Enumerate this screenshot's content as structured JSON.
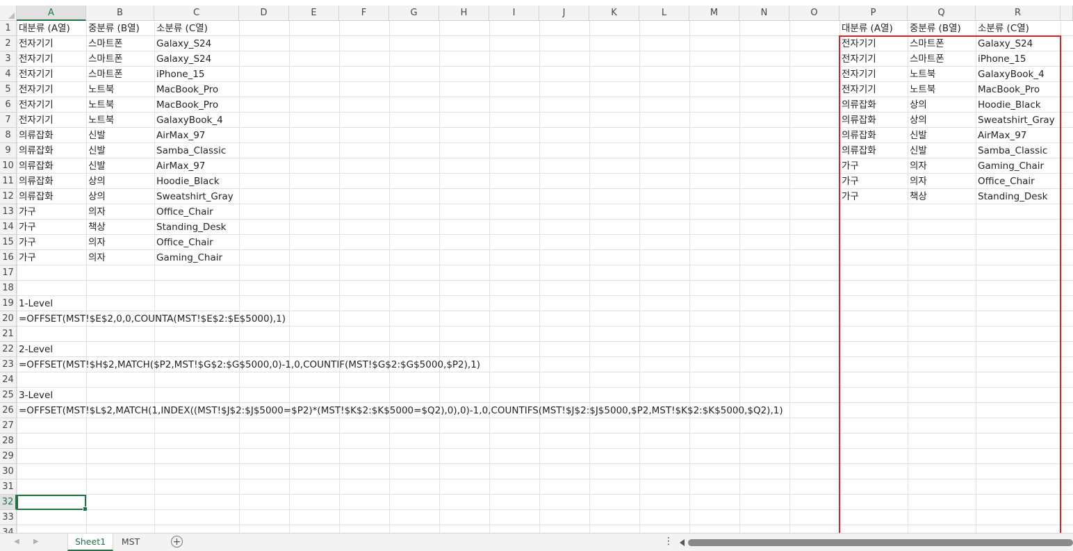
{
  "columns": [
    "A",
    "B",
    "C",
    "D",
    "E",
    "F",
    "G",
    "H",
    "I",
    "J",
    "K",
    "L",
    "M",
    "N",
    "O",
    "P",
    "Q",
    "R"
  ],
  "rows": [
    "1",
    "2",
    "3",
    "4",
    "5",
    "6",
    "7",
    "8",
    "9",
    "10",
    "11",
    "12",
    "13",
    "14",
    "15",
    "16",
    "17",
    "18",
    "19",
    "20",
    "21",
    "22",
    "23",
    "24",
    "25",
    "26",
    "27",
    "28",
    "29",
    "30",
    "31",
    "32",
    "33",
    "34"
  ],
  "selected_cell": "A32",
  "cells": {
    "A1": "대분류 (A열)",
    "B1": "중분류 (B열)",
    "C1": "소분류 (C열)",
    "A2": "전자기기",
    "B2": "스마트폰",
    "C2": "Galaxy_S24",
    "A3": "전자기기",
    "B3": "스마트폰",
    "C3": "Galaxy_S24",
    "A4": "전자기기",
    "B4": "스마트폰",
    "C4": "iPhone_15",
    "A5": "전자기기",
    "B5": "노트북",
    "C5": "MacBook_Pro",
    "A6": "전자기기",
    "B6": "노트북",
    "C6": "MacBook_Pro",
    "A7": "전자기기",
    "B7": "노트북",
    "C7": "GalaxyBook_4",
    "A8": "의류잡화",
    "B8": "신발",
    "C8": "AirMax_97",
    "A9": "의류잡화",
    "B9": "신발",
    "C9": "Samba_Classic",
    "A10": "의류잡화",
    "B10": "신발",
    "C10": "AirMax_97",
    "A11": "의류잡화",
    "B11": "상의",
    "C11": "Hoodie_Black",
    "A12": "의류잡화",
    "B12": "상의",
    "C12": "Sweatshirt_Gray",
    "A13": "가구",
    "B13": "의자",
    "C13": "Office_Chair",
    "A14": "가구",
    "B14": "책상",
    "C14": "Standing_Desk",
    "A15": "가구",
    "B15": "의자",
    "C15": "Office_Chair",
    "A16": "가구",
    "B16": "의자",
    "C16": "Gaming_Chair",
    "A19": "1-Level",
    "A20": "=OFFSET(MST!$E$2,0,0,COUNTA(MST!$E$2:$E$5000),1)",
    "A22": "2-Level",
    "A23": "=OFFSET(MST!$H$2,MATCH($P2,MST!$G$2:$G$5000,0)-1,0,COUNTIF(MST!$G$2:$G$5000,$P2),1)",
    "A25": "3-Level",
    "A26": "=OFFSET(MST!$L$2,MATCH(1,INDEX((MST!$J$2:$J$5000=$P2)*(MST!$K$2:$K$5000=$Q2),0),0)-1,0,COUNTIFS(MST!$J$2:$J$5000,$P2,MST!$K$2:$K$5000,$Q2),1)",
    "P1": "대분류 (A열)",
    "Q1": "중분류 (B열)",
    "R1": "소분류 (C열)",
    "P2": "전자기기",
    "Q2": "스마트폰",
    "R2": "Galaxy_S24",
    "P3": "전자기기",
    "Q3": "스마트폰",
    "R3": "iPhone_15",
    "P4": "전자기기",
    "Q4": "노트북",
    "R4": "GalaxyBook_4",
    "P5": "전자기기",
    "Q5": "노트북",
    "R5": "MacBook_Pro",
    "P6": "의류잡화",
    "Q6": "상의",
    "R6": "Hoodie_Black",
    "P7": "의류잡화",
    "Q7": "상의",
    "R7": "Sweatshirt_Gray",
    "P8": "의류잡화",
    "Q8": "신발",
    "R8": "AirMax_97",
    "P9": "의류잡화",
    "Q9": "신발",
    "R9": "Samba_Classic",
    "P10": "가구",
    "Q10": "의자",
    "R10": "Gaming_Chair",
    "P11": "가구",
    "Q11": "의자",
    "R11": "Office_Chair",
    "P12": "가구",
    "Q12": "책상",
    "R12": "Standing_Desk"
  },
  "sheet_tabs": [
    {
      "label": "Sheet1",
      "active": true
    },
    {
      "label": "MST",
      "active": false
    }
  ],
  "icons": {
    "add_sheet": "plus-circle-icon",
    "more": "vertical-dots-icon",
    "scroll_left": "triangle-left-icon"
  },
  "colors": {
    "accent": "#217346",
    "highlight_box": "#e02020"
  }
}
